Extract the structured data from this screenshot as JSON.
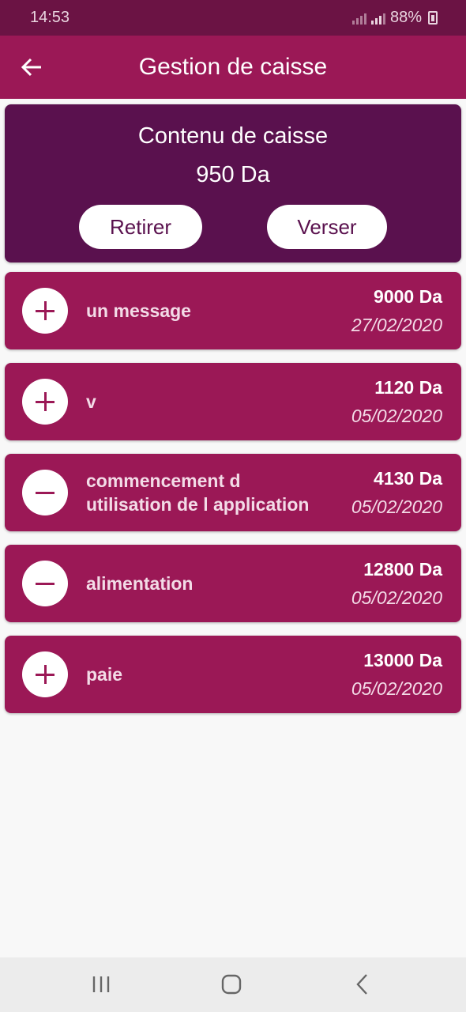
{
  "status_bar": {
    "time": "14:53",
    "battery": "88%"
  },
  "header": {
    "title": "Gestion de caisse"
  },
  "summary": {
    "title": "Contenu de caisse",
    "amount": "950 Da",
    "withdraw_label": "Retirer",
    "deposit_label": "Verser"
  },
  "transactions": [
    {
      "icon": "plus-icon",
      "label": "un message",
      "amount": "9000 Da",
      "date": "27/02/2020"
    },
    {
      "icon": "plus-icon",
      "label": "v",
      "amount": "1120 Da",
      "date": "05/02/2020"
    },
    {
      "icon": "minus-icon",
      "label": "commencement d utilisation de l application",
      "amount": "4130 Da",
      "date": "05/02/2020"
    },
    {
      "icon": "minus-icon",
      "label": "alimentation",
      "amount": "12800 Da",
      "date": "05/02/2020"
    },
    {
      "icon": "plus-icon",
      "label": "paie",
      "amount": "13000 Da",
      "date": "05/02/2020"
    }
  ],
  "colors": {
    "status_bar": "#6b1344",
    "app_bar": "#9b1856",
    "summary_card": "#5a114e",
    "transaction_card": "#9b1856"
  }
}
